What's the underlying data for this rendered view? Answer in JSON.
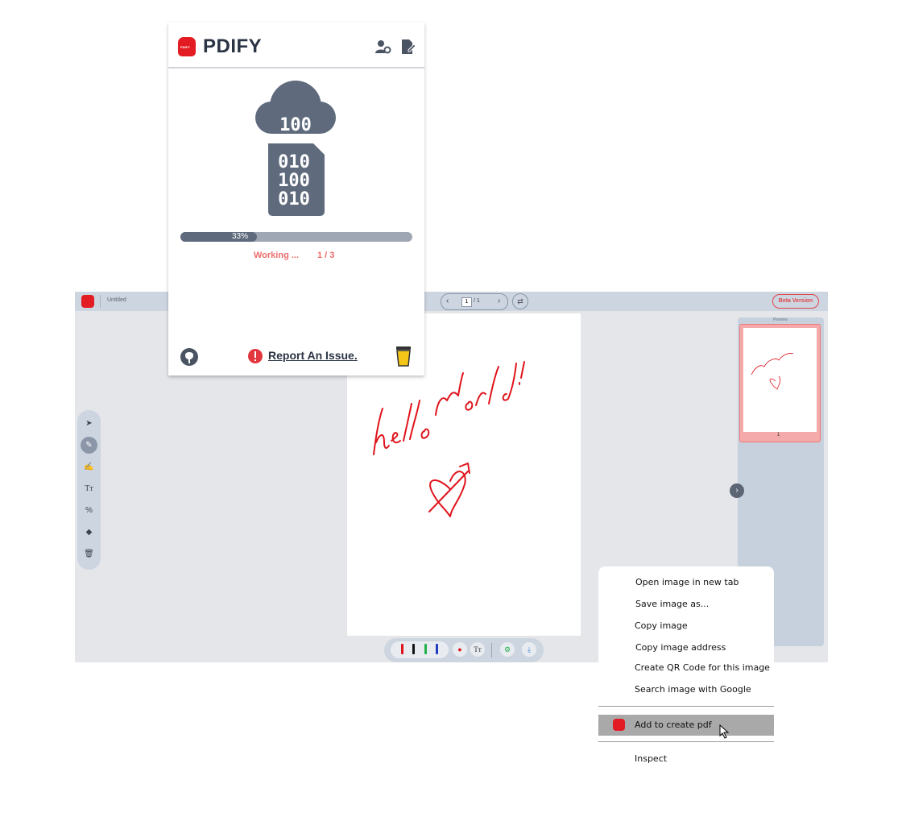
{
  "editor": {
    "doc_title": "Untitled",
    "page_current": "1",
    "page_total": "/ 1",
    "beta_label": "Beta Version",
    "preview_label": "Preview",
    "thumb_page_number": "1",
    "handwriting": "hello World!",
    "colors": {
      "pen_red": "#e0141c",
      "pen_black": "#111111",
      "pen_green": "#22b24c",
      "pen_blue": "#1e3fc2"
    }
  },
  "modal": {
    "brand": "PDIFY",
    "progress_percent": 33,
    "progress_label": "33%",
    "status": "Working ...",
    "count": "1 / 3",
    "report_label": "Report An Issue.",
    "icons": [
      "user-settings-icon",
      "edit-document-icon",
      "cloud-binary-icon",
      "github-icon",
      "alert-icon",
      "coffee-cup-icon"
    ]
  },
  "context_menu": {
    "items": [
      "Open image in new tab",
      "Save image as...",
      "Copy image",
      "Copy image address",
      "Create QR Code for this image",
      "Search image with Google"
    ],
    "extension_item": "Add to create pdf",
    "inspect": "Inspect"
  }
}
